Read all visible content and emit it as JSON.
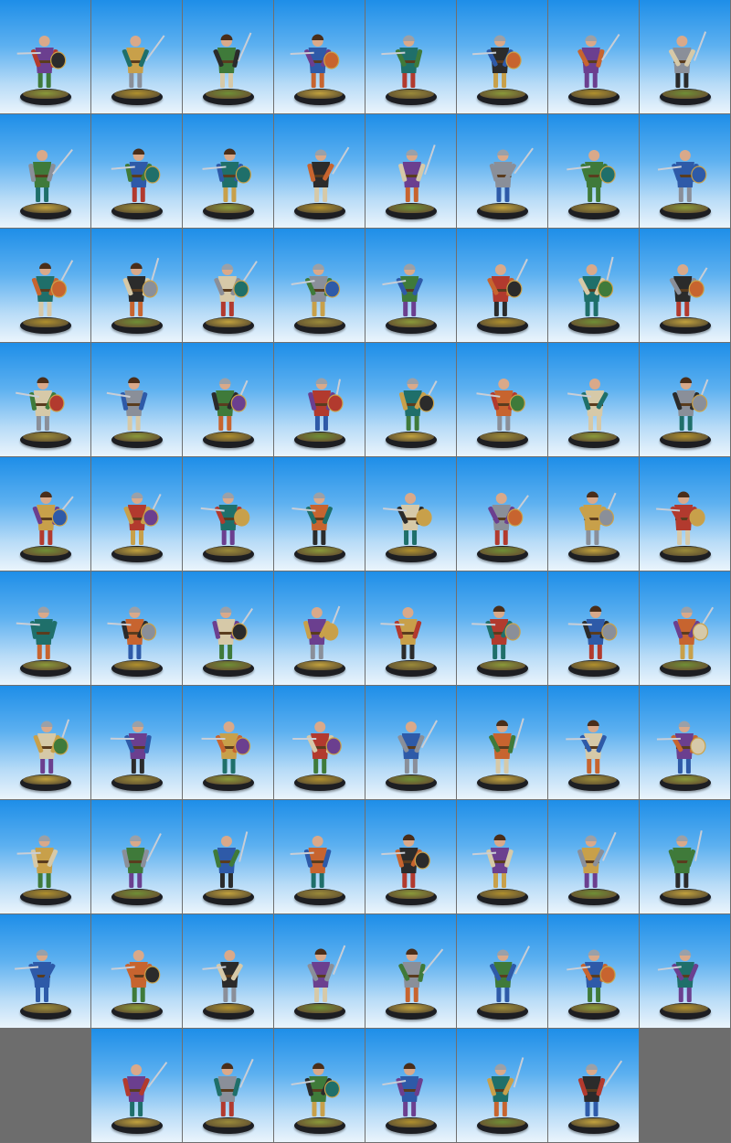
{
  "gallery": {
    "columns": 8,
    "rows": 10,
    "cell_count": 80,
    "empty_cells": [
      72,
      79
    ],
    "background_gradient": [
      "#1e8ee8",
      "#eaf4fc"
    ],
    "filler_color": "#6d6d6d",
    "subject": "painted-fantasy-miniature",
    "palette": [
      "#2e5aa8",
      "#b23a2e",
      "#3f7a3a",
      "#c8a04a",
      "#8a8f99",
      "#6b3f8f",
      "#d6c9a8",
      "#2b2b2b",
      "#c7642f",
      "#1f6f6a"
    ]
  }
}
